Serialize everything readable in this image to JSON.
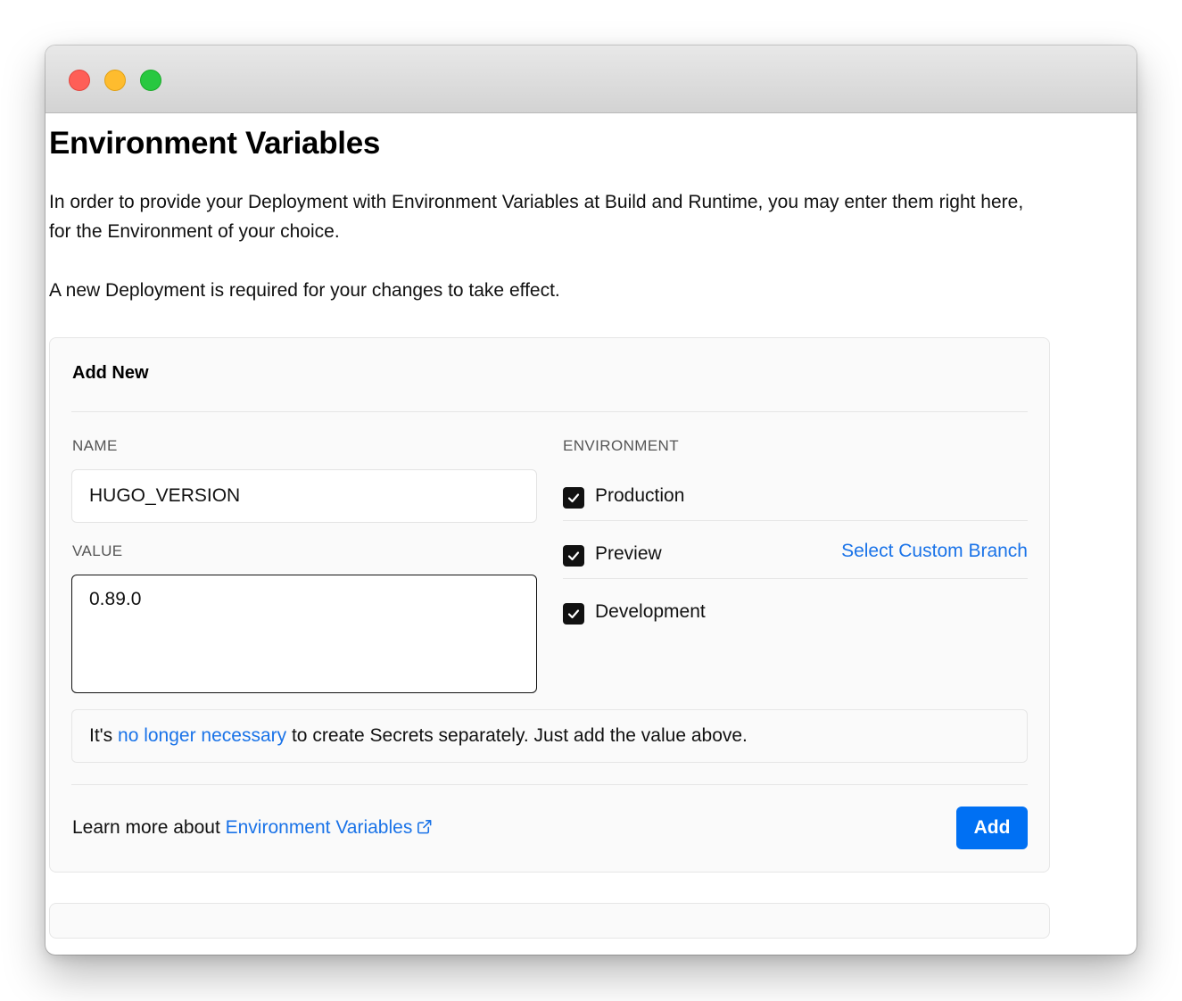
{
  "window": {
    "traffic_lights": {
      "close": "#fe5f57",
      "minimize": "#febc2e",
      "zoom": "#28c840"
    }
  },
  "page": {
    "title": "Environment Variables",
    "description": "In order to provide your Deployment with Environment Variables at Build and Runtime, you may enter them right here, for the Environment of your choice.",
    "note": "A new Deployment is required for your changes to take effect."
  },
  "add_new": {
    "heading": "Add New",
    "name_label": "NAME",
    "name_value": "HUGO_VERSION",
    "value_label": "VALUE",
    "value_value": "0.89.0",
    "environment_label": "ENVIRONMENT",
    "environments": [
      {
        "label": "Production",
        "checked": true
      },
      {
        "label": "Preview",
        "checked": true
      },
      {
        "label": "Development",
        "checked": true
      }
    ],
    "select_custom_branch": "Select Custom Branch",
    "notice_prefix": "It's ",
    "notice_link": "no longer necessary",
    "notice_suffix": " to create Secrets separately. Just add the value above.",
    "learn_more_prefix": "Learn more about ",
    "learn_more_link": "Environment Variables",
    "external_link_icon": "external-link-icon",
    "add_button": "Add"
  },
  "colors": {
    "accent": "#0070f3",
    "link": "#1a73e8",
    "checkbox": "#111111"
  }
}
